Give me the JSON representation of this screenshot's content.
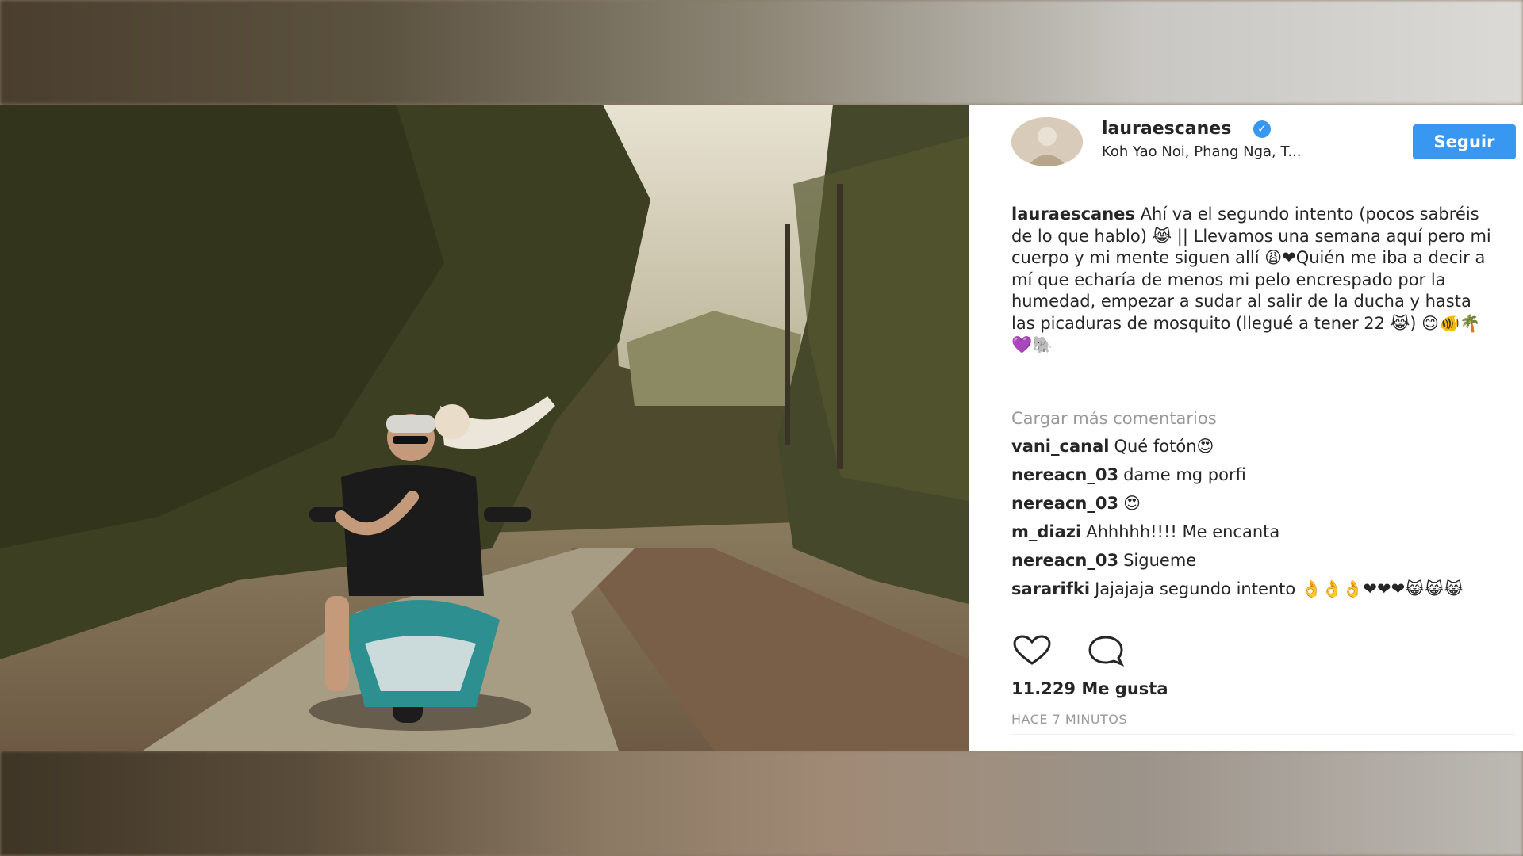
{
  "post": {
    "username": "lauraescanes",
    "location": "Koh Yao Noi, Phang Nga, T...",
    "follow_label": "Seguir",
    "caption": {
      "username": "lauraescanes",
      "text": "Ahí va el segundo intento (pocos sabréis de lo que hablo) 😹 || Llevamos una semana aquí pero mi cuerpo y mi mente siguen allí 😩❤Quién me iba a decir a mí que echaría de menos mi pelo encrespado por la humedad, empezar a sudar al salir de la ducha y hasta las picaduras de mosquito (llegué a tener 22 😹) 😊🐠🌴💜🐘"
    },
    "more_comments_label": "Cargar más comentarios",
    "comments": [
      {
        "user": "vani_canal",
        "text": "Qué fotón😍"
      },
      {
        "user": "nereacn_03",
        "text": "dame mg porfi"
      },
      {
        "user": "nereacn_03",
        "text": "😍"
      },
      {
        "user": "m_diazi",
        "text": "Ahhhhh!!!! Me encanta"
      },
      {
        "user": "nereacn_03",
        "text": "Sigueme"
      },
      {
        "user": "sararifki",
        "text": "Jajajaja segundo intento 👌👌👌❤❤❤😹😹😹"
      }
    ],
    "likes": "11.229 Me gusta",
    "timestamp": "HACE 7 MINUTOS"
  },
  "icons": {
    "like": "heart-icon",
    "comment": "comment-icon",
    "verified": "verified-badge-icon"
  },
  "colors": {
    "accent": "#3897f0",
    "text": "#262626",
    "muted": "#999999"
  }
}
